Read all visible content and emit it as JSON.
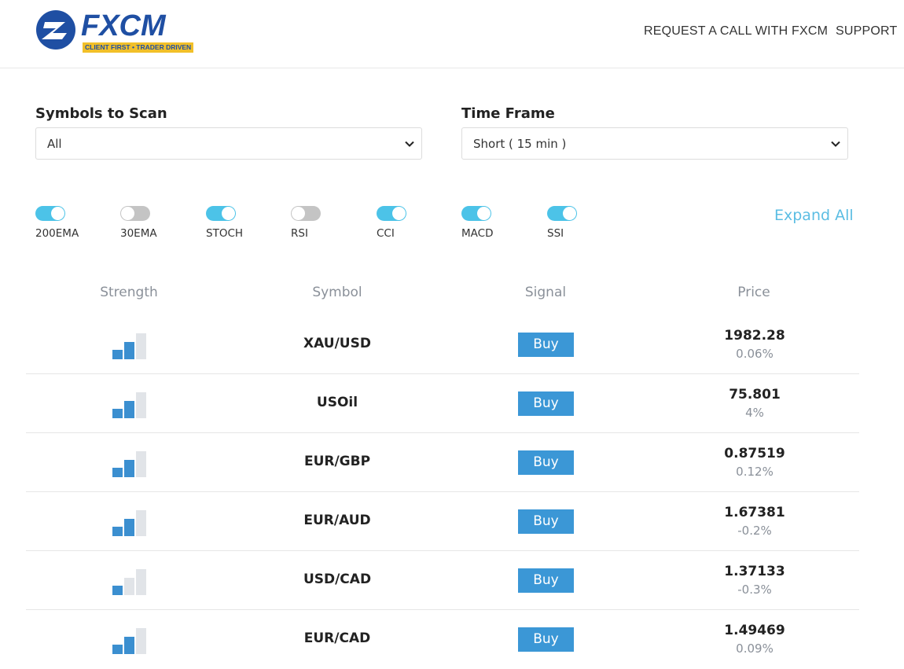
{
  "header": {
    "logo_text": "FXCM",
    "tagline": "CLIENT FIRST • TRADER DRIVEN",
    "nav": {
      "request_call": "REQUEST A CALL WITH FXCM",
      "support": "SUPPORT"
    }
  },
  "filters": {
    "symbols": {
      "label": "Symbols to Scan",
      "value": "All"
    },
    "timeframe": {
      "label": "Time Frame",
      "value": "Short ( 15 min )"
    }
  },
  "toggles": [
    {
      "label": "200EMA",
      "on": true
    },
    {
      "label": "30EMA",
      "on": false
    },
    {
      "label": "STOCH",
      "on": true
    },
    {
      "label": "RSI",
      "on": false
    },
    {
      "label": "CCI",
      "on": true
    },
    {
      "label": "MACD",
      "on": true
    },
    {
      "label": "SSI",
      "on": true
    }
  ],
  "expand_all": "Expand All",
  "table": {
    "headers": {
      "strength": "Strength",
      "symbol": "Symbol",
      "signal": "Signal",
      "price": "Price"
    },
    "rows": [
      {
        "strength": 2,
        "symbol": "XAU/USD",
        "signal": "Buy",
        "price": "1982.28",
        "change": "0.06%"
      },
      {
        "strength": 2,
        "symbol": "USOil",
        "signal": "Buy",
        "price": "75.801",
        "change": "4%"
      },
      {
        "strength": 2,
        "symbol": "EUR/GBP",
        "signal": "Buy",
        "price": "0.87519",
        "change": "0.12%"
      },
      {
        "strength": 2,
        "symbol": "EUR/AUD",
        "signal": "Buy",
        "price": "1.67381",
        "change": "-0.2%"
      },
      {
        "strength": 1,
        "symbol": "USD/CAD",
        "signal": "Buy",
        "price": "1.37133",
        "change": "-0.3%"
      },
      {
        "strength": 2,
        "symbol": "EUR/CAD",
        "signal": "Buy",
        "price": "1.49469",
        "change": "0.09%"
      }
    ]
  },
  "colors": {
    "brand_blue": "#1f4fa3",
    "brand_yellow": "#f2c029",
    "toggle_on": "#4cc3e8",
    "toggle_off": "#c4c4c4",
    "buy_button": "#3b97d6",
    "strength_filled": "#3b8fd0",
    "strength_empty": "#e1e4e8"
  }
}
